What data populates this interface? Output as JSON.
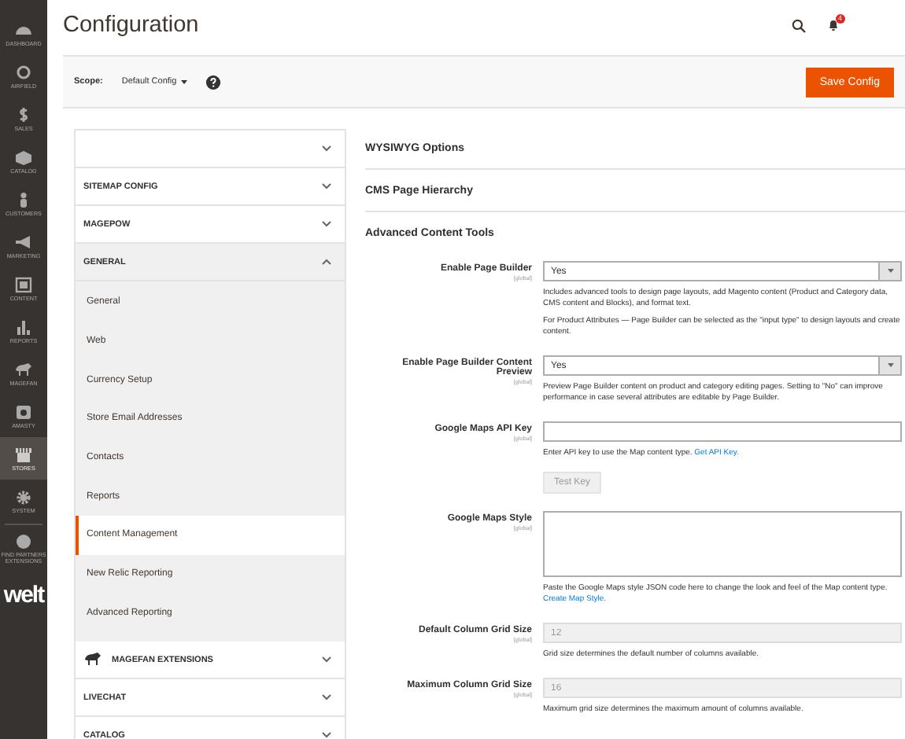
{
  "nav": {
    "items": [
      {
        "label": "DASHBOARD",
        "selected": false
      },
      {
        "label": "AIRFIELD",
        "selected": false
      },
      {
        "label": "SALES",
        "selected": false
      },
      {
        "label": "CATALOG",
        "selected": false
      },
      {
        "label": "CUSTOMERS",
        "selected": false
      },
      {
        "label": "MARKETING",
        "selected": false
      },
      {
        "label": "CONTENT",
        "selected": false
      },
      {
        "label": "REPORTS",
        "selected": false
      },
      {
        "label": "MAGEFAN",
        "selected": false
      },
      {
        "label": "AMASTY",
        "selected": false
      },
      {
        "label": "STORES",
        "selected": true
      },
      {
        "label": "SYSTEM",
        "selected": false
      },
      {
        "label": "FIND PARTNERS EXTENSIONS",
        "selected": false
      }
    ],
    "logo": "welt"
  },
  "header": {
    "title": "Configuration",
    "notification_count": "4"
  },
  "scope_bar": {
    "label": "Scope:",
    "value": "Default Config",
    "button": "Save Config"
  },
  "tabs": [
    {
      "expanded": false
    },
    {
      "label": "SITEMAP CONFIG",
      "expanded": false
    },
    {
      "label": "MAGEPOW",
      "expanded": false
    },
    {
      "label": "GENERAL",
      "expanded": true,
      "children": [
        {
          "label": "General",
          "selected": false
        },
        {
          "label": "Web",
          "selected": false
        },
        {
          "label": "Currency Setup",
          "selected": false
        },
        {
          "label": "Store Email Addresses",
          "selected": false
        },
        {
          "label": "Contacts",
          "selected": false
        },
        {
          "label": "Reports",
          "selected": false
        },
        {
          "label": "Content Management",
          "selected": true
        },
        {
          "label": "New Relic Reporting",
          "selected": false
        },
        {
          "label": "Advanced Reporting",
          "selected": false
        }
      ]
    },
    {
      "label": "MAGEFAN EXTENSIONS",
      "expanded": false,
      "kind": "icon"
    },
    {
      "label": "LIVECHAT",
      "expanded": false
    },
    {
      "label": "CATALOG",
      "expanded": false
    }
  ],
  "sections": [
    {
      "title": "WYSIWYG Options"
    },
    {
      "title": "CMS Page Hierarchy"
    },
    {
      "title": "Advanced Content Tools"
    }
  ],
  "fields": [
    {
      "kind": "select",
      "label": "Enable Page Builder",
      "scope": "[global]",
      "value": "Yes",
      "notes": [
        {
          "text": "Includes advanced tools to design page layouts, add Magento content (Product and Category data, CMS content and Blocks), and format text."
        },
        {
          "text": "For Product Attributes — Page Builder can be selected as the \"input type\" to design layouts and create content."
        }
      ]
    },
    {
      "kind": "select",
      "label": "Enable Page Builder Content Preview",
      "scope": "[global]",
      "value": "Yes",
      "notes": [
        {
          "text": "Preview Page Builder content on product and category editing pages. Setting to \"No\" can improve performance in case several attributes are editable by Page Builder."
        }
      ]
    },
    {
      "kind": "text",
      "label": "Google Maps API Key",
      "scope": "[global]",
      "notes": [
        {
          "text": "Enter API key to use the Map content type.",
          "link": "Get API Key."
        }
      ]
    },
    {
      "kind": "button",
      "value": "Test Key"
    },
    {
      "kind": "textarea",
      "label": "Google Maps Style",
      "scope": "[global]",
      "notes": [
        {
          "text": "Paste the Google Maps style JSON code here to change the look and feel of the Map content type.",
          "link": "Create Map Style."
        }
      ]
    },
    {
      "kind": "text",
      "label": "Default Column Grid Size",
      "scope": "[global]",
      "value": "12",
      "disabled": true,
      "notes": [
        {
          "text": "Grid size determines the default number of columns available."
        }
      ]
    },
    {
      "kind": "text",
      "label": "Maximum Column Grid Size",
      "scope": "[global]",
      "value": "16",
      "disabled": true,
      "notes": [
        {
          "text": "Maximum grid size determines the maximum amount of columns available."
        }
      ]
    }
  ]
}
